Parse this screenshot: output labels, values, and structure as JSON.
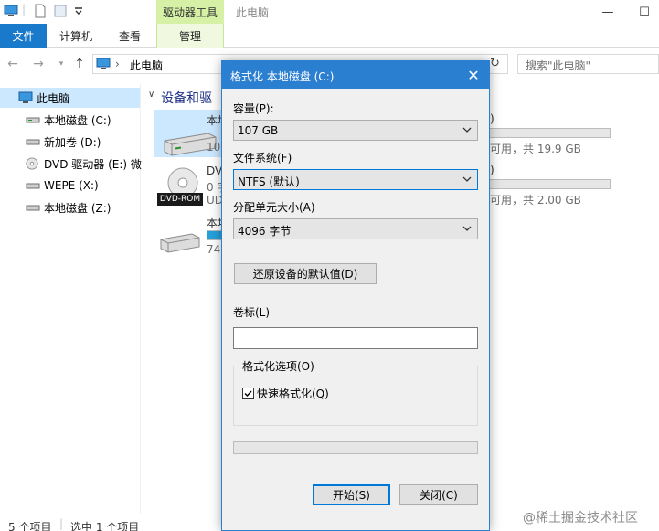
{
  "window": {
    "title": "此电脑",
    "context_tab": "驱动器工具",
    "accent_color": "#1979ca",
    "context_color": "#d6f0a5"
  },
  "ribbon": {
    "tabs": [
      "文件",
      "计算机",
      "查看",
      "管理"
    ]
  },
  "address_bar": {
    "path": "此电脑",
    "search_placeholder": "搜索\"此电脑\""
  },
  "sidebar": {
    "items": [
      {
        "label": "此电脑",
        "icon": "computer-icon",
        "selected": true
      },
      {
        "label": "本地磁盘 (C:)",
        "icon": "drive-icon"
      },
      {
        "label": "新加卷 (D:)",
        "icon": "drive-icon"
      },
      {
        "label": "DVD 驱动器 (E:) 微",
        "icon": "dvd-icon"
      },
      {
        "label": "WEPE (X:)",
        "icon": "drive-icon"
      },
      {
        "label": "本地磁盘 (Z:)",
        "icon": "drive-icon"
      }
    ]
  },
  "content": {
    "group_title": "设备和驱",
    "drives": [
      {
        "name_fragment": "本地",
        "detail_fragment": "107",
        "free_text": "可用，共 19.9 GB",
        "used_fraction": 0.0
      },
      {
        "name_fragment": "DVD",
        "detail_fragment": "0 字",
        "extra_fragment": "UD",
        "free_text": "可用，共 2.00 GB",
        "dvd_badge": "DVD-ROM",
        "used_fraction": 0.0
      },
      {
        "name_fragment": "本地",
        "detail_fragment": "74.",
        "used_fraction": 0.6
      }
    ],
    "paren_fragments": [
      ")",
      ")"
    ]
  },
  "status": {
    "item_count": "5 个项目",
    "selected": "选中 1 个项目"
  },
  "dialog": {
    "title": "格式化 本地磁盘 (C:)",
    "capacity_label": "容量(P):",
    "capacity_value": "107 GB",
    "filesystem_label": "文件系统(F)",
    "filesystem_value": "NTFS (默认)",
    "unit_label": "分配单元大小(A)",
    "unit_value": "4096 字节",
    "restore_button": "还原设备的默认值(D)",
    "volume_label": "卷标(L)",
    "volume_value": "",
    "options_legend": "格式化选项(O)",
    "quick_format_label": "快速格式化(Q)",
    "quick_format_checked": true,
    "progress": 0,
    "start_button": "开始(S)",
    "close_button": "关闭(C)"
  },
  "watermark": "@稀土掘金技术社区"
}
